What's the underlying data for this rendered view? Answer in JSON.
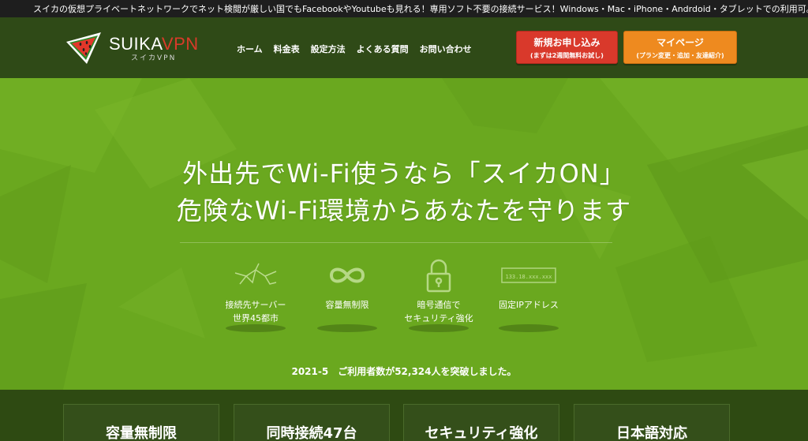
{
  "topbar": {
    "text": "スイカの仮想プライベートネットワークでネット検閲が厳しい国でもFacebookやYoutubeも見れる！専用ソフト不要の接続サービス！Windows・Mac・iPhone・Andrdoid・タブレットでの利用可。"
  },
  "logo": {
    "main": "SUIKA",
    "accent": "VPN",
    "sub": "スイカVPN"
  },
  "nav": {
    "items": [
      "ホーム",
      "料金表",
      "設定方法",
      "よくある質問",
      "お問い合わせ"
    ]
  },
  "buttons": {
    "signup_main": "新規お申し込み",
    "signup_sub": "(まずは2週間無料お試し)",
    "mypage_main": "マイページ",
    "mypage_sub": "(プラン変更・追加・友達紹介)"
  },
  "hero": {
    "line1": "外出先でWi-Fi使うなら「スイカON」",
    "line2": "危険なWi-Fi環境からあなたを守ります"
  },
  "features": [
    {
      "icon": "network-icon",
      "line1": "接続先サーバー",
      "line2": "世界45都市"
    },
    {
      "icon": "infinity-icon",
      "line1": "容量無制限",
      "line2": ""
    },
    {
      "icon": "lock-icon",
      "line1": "暗号通信で",
      "line2": "セキュリティ強化"
    },
    {
      "icon": "ip-address-icon",
      "line1": "固定IPアドレス",
      "line2": "",
      "ip_text": "133.18.xxx.xxx"
    }
  ],
  "notice": "2021-5　ご利用者数が52,324人を突破しました。",
  "cards": [
    "容量無制限",
    "同時接続47台",
    "セキュリティ強化",
    "日本語対応"
  ],
  "colors": {
    "header_bg": "#2f4a17",
    "hero_bg": "#6aa81f",
    "signup": "#d9392b",
    "mypage": "#ee8a1f",
    "vpn_accent": "#d93b2a"
  }
}
